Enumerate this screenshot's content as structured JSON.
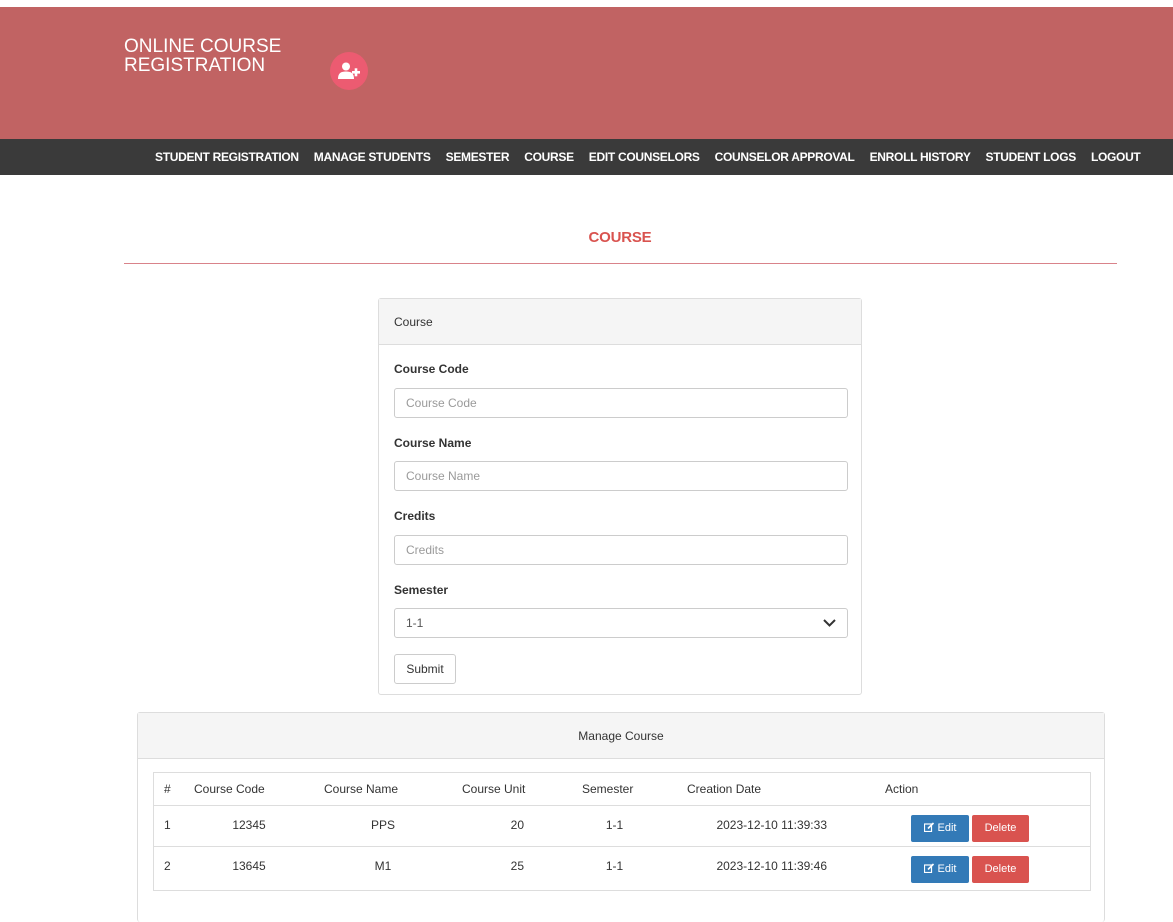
{
  "app": {
    "title_line1": "ONLINE COURSE",
    "title_line2": "REGISTRATION",
    "badge_icon": "user-plus-icon"
  },
  "nav": {
    "items": [
      {
        "label": "STUDENT REGISTRATION"
      },
      {
        "label": "MANAGE STUDENTS"
      },
      {
        "label": "SEMESTER"
      },
      {
        "label": "COURSE"
      },
      {
        "label": "EDIT COUNSELORS"
      },
      {
        "label": "COUNSELOR APPROVAL"
      },
      {
        "label": "ENROLL HISTORY"
      },
      {
        "label": "STUDENT LOGS"
      },
      {
        "label": "LOGOUT"
      }
    ]
  },
  "page": {
    "title": "COURSE"
  },
  "form": {
    "heading": "Course",
    "course_code": {
      "label": "Course Code",
      "placeholder": "Course Code",
      "value": ""
    },
    "course_name": {
      "label": "Course Name",
      "placeholder": "Course Name",
      "value": ""
    },
    "credits": {
      "label": "Credits",
      "placeholder": "Credits",
      "value": ""
    },
    "semester": {
      "label": "Semester",
      "selected": "1-1"
    },
    "submit_label": "Submit"
  },
  "manage": {
    "heading": "Manage Course",
    "columns": [
      "#",
      "Course Code",
      "Course Name",
      "Course Unit",
      "Semester",
      "Creation Date",
      "Action"
    ],
    "rows": [
      {
        "num": "1",
        "code": "12345",
        "name": "PPS",
        "unit": "20",
        "semester": "1-1",
        "created": "2023-12-10 11:39:33"
      },
      {
        "num": "2",
        "code": "13645",
        "name": "M1",
        "unit": "25",
        "semester": "1-1",
        "created": "2023-12-10 11:39:46"
      }
    ],
    "edit_label": "Edit",
    "delete_label": "Delete"
  },
  "colors": {
    "header": "#c16363",
    "navbar": "#3a3a3a",
    "title": "#d9534f",
    "edit": "#337ab7",
    "delete": "#d9534f"
  }
}
